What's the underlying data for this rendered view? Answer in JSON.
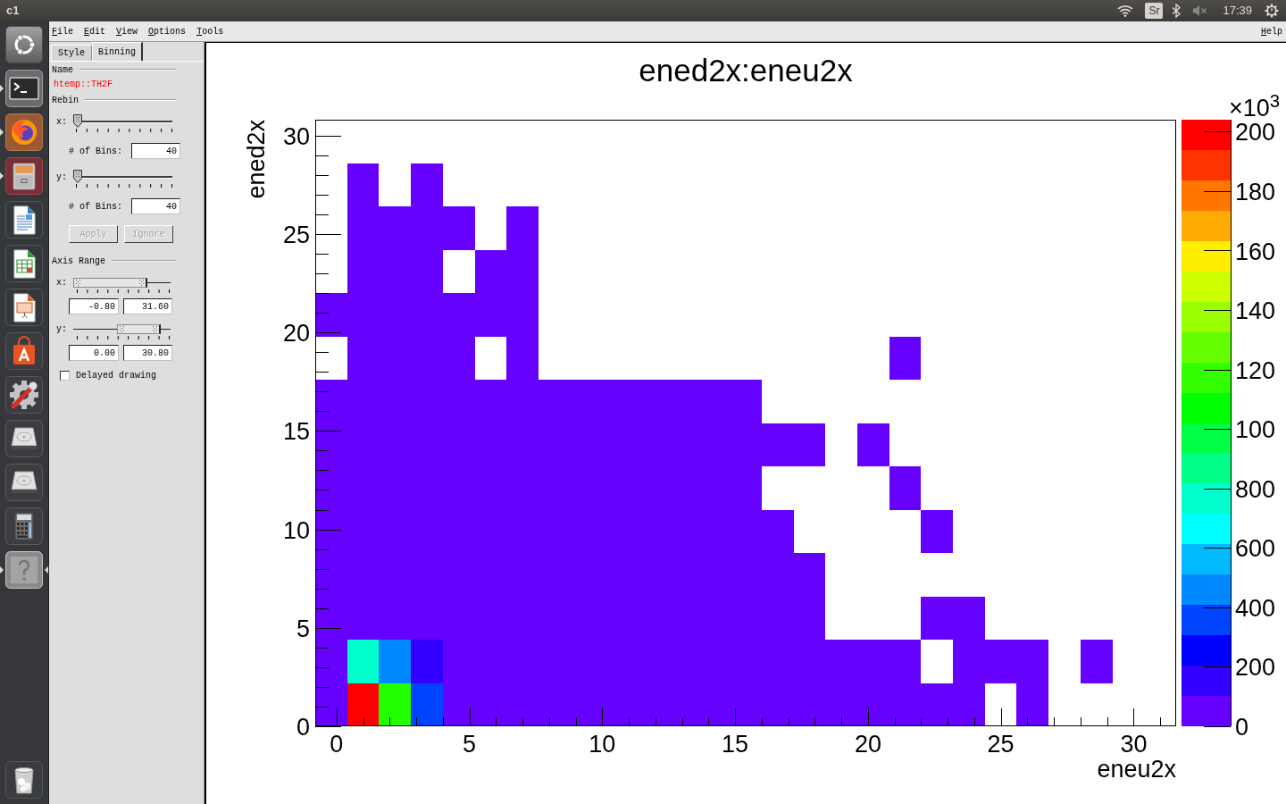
{
  "top_bar": {
    "title": "c1",
    "keyboard_layout": "Sr",
    "sound_muted": true,
    "clock": "17:39"
  },
  "launcher": {
    "items": [
      {
        "kind": "home",
        "running": false,
        "focused": false
      },
      {
        "kind": "terminal",
        "running": true,
        "focused": false
      },
      {
        "kind": "browser",
        "running": true,
        "focused": false
      },
      {
        "kind": "files",
        "running": true,
        "focused": false
      },
      {
        "kind": "writer",
        "running": false,
        "focused": false
      },
      {
        "kind": "spreadsheet",
        "running": false,
        "focused": false
      },
      {
        "kind": "presentation",
        "running": false,
        "focused": false
      },
      {
        "kind": "store",
        "running": false,
        "focused": false
      },
      {
        "kind": "settings",
        "running": false,
        "focused": false
      },
      {
        "kind": "disk",
        "running": false,
        "focused": false
      },
      {
        "kind": "disk",
        "running": false,
        "focused": false
      },
      {
        "kind": "calculator",
        "running": false,
        "focused": false
      },
      {
        "kind": "unknown",
        "running": true,
        "focused": true
      },
      {
        "kind": "trash",
        "running": false,
        "focused": false
      }
    ]
  },
  "menu_bar": {
    "menus": [
      "File",
      "Edit",
      "View",
      "Options",
      "Tools"
    ],
    "help_menu": "Help"
  },
  "editor": {
    "tabs": [
      {
        "label": "Style",
        "selected": false
      },
      {
        "label": "Binning",
        "selected": true
      }
    ],
    "name_section": {
      "heading": "Name",
      "object_name": "htemp::TH2F"
    },
    "rebin": {
      "heading": "Rebin",
      "axes": [
        {
          "label": "x:",
          "level": 0,
          "bins_label": "# of Bins:",
          "bins": "40"
        },
        {
          "label": "y:",
          "level": 0,
          "bins_label": "# of Bins:",
          "bins": "40"
        }
      ]
    },
    "buttons": [
      {
        "label": "Apply",
        "disabled": true
      },
      {
        "label": "Ignore",
        "disabled": true
      }
    ],
    "axis_range": {
      "heading": "Axis Range",
      "axes": [
        {
          "label": "x:",
          "thumbs": [
            {
              "level": 0
            },
            {
              "level": 0.76
            }
          ],
          "min": "-0.80",
          "max": "31.60"
        },
        {
          "label": "y:",
          "thumbs": [
            {
              "level": 0.45
            },
            {
              "level": 0.9
            }
          ],
          "min": "0.00",
          "max": "30.80"
        }
      ]
    },
    "delayed_drawing": {
      "label": "Delayed drawing",
      "checked": false
    }
  },
  "canvas": {
    "histogram_2d": {
      "title": "ened2x:eneu2x",
      "y_axis": {
        "title": "ened2x",
        "labels": [
          "30",
          "25",
          "20",
          "15",
          "10",
          "5",
          "0"
        ]
      },
      "rows": [
        {
          "cells": [
            {
              "kind": "gap"
            },
            {
              "kind": "bin",
              "color": "#6600ff"
            },
            {
              "kind": "gap"
            },
            {
              "kind": "bin",
              "color": "#6600ff"
            }
          ]
        },
        {
          "cells": [
            {
              "kind": "gap"
            },
            {
              "kind": "bin",
              "color": "#6600ff"
            },
            {
              "kind": "bin",
              "color": "#6600ff"
            },
            {
              "kind": "bin",
              "color": "#6600ff"
            },
            {
              "kind": "bin",
              "color": "#6600ff"
            },
            {
              "kind": "gap"
            },
            {
              "kind": "bin",
              "color": "#6600ff"
            }
          ]
        },
        {
          "cells": [
            {
              "kind": "gap"
            },
            {
              "kind": "bin",
              "color": "#6600ff"
            },
            {
              "kind": "bin",
              "color": "#6600ff"
            },
            {
              "kind": "bin",
              "color": "#6600ff"
            },
            {
              "kind": "gap"
            },
            {
              "kind": "bin",
              "color": "#6600ff"
            },
            {
              "kind": "bin",
              "color": "#6600ff"
            }
          ]
        },
        {
          "cells": [
            {
              "kind": "bin",
              "color": "#6600ff"
            },
            {
              "kind": "bin",
              "color": "#6600ff"
            },
            {
              "kind": "bin",
              "color": "#6600ff"
            },
            {
              "kind": "bin",
              "color": "#6600ff"
            },
            {
              "kind": "bin",
              "color": "#6600ff"
            },
            {
              "kind": "bin",
              "color": "#6600ff"
            },
            {
              "kind": "bin",
              "color": "#6600ff"
            }
          ]
        },
        {
          "cells": [
            {
              "kind": "gap"
            },
            {
              "kind": "bin",
              "color": "#6600ff"
            },
            {
              "kind": "bin",
              "color": "#6600ff"
            },
            {
              "kind": "bin",
              "color": "#6600ff"
            },
            {
              "kind": "bin",
              "color": "#6600ff"
            },
            {
              "kind": "gap"
            },
            {
              "kind": "bin",
              "color": "#6600ff"
            },
            {
              "kind": "gap"
            },
            {
              "kind": "gap"
            },
            {
              "kind": "gap"
            },
            {
              "kind": "gap"
            },
            {
              "kind": "gap"
            },
            {
              "kind": "gap"
            },
            {
              "kind": "gap"
            },
            {
              "kind": "gap"
            },
            {
              "kind": "gap"
            },
            {
              "kind": "gap"
            },
            {
              "kind": "gap"
            },
            {
              "kind": "bin",
              "color": "#6600ff"
            }
          ]
        },
        {
          "cells": [
            {
              "kind": "bin",
              "color": "#6600ff"
            },
            {
              "kind": "bin",
              "color": "#6600ff"
            },
            {
              "kind": "bin",
              "color": "#6600ff"
            },
            {
              "kind": "bin",
              "color": "#6600ff"
            },
            {
              "kind": "bin",
              "color": "#6600ff"
            },
            {
              "kind": "bin",
              "color": "#6600ff"
            },
            {
              "kind": "bin",
              "color": "#6600ff"
            },
            {
              "kind": "bin",
              "color": "#6600ff"
            },
            {
              "kind": "bin",
              "color": "#6600ff"
            },
            {
              "kind": "bin",
              "color": "#6600ff"
            },
            {
              "kind": "bin",
              "color": "#6600ff"
            },
            {
              "kind": "bin",
              "color": "#6600ff"
            },
            {
              "kind": "bin",
              "color": "#6600ff"
            },
            {
              "kind": "bin",
              "color": "#6600ff"
            }
          ]
        },
        {
          "cells": [
            {
              "kind": "bin",
              "color": "#6600ff"
            },
            {
              "kind": "bin",
              "color": "#6600ff"
            },
            {
              "kind": "bin",
              "color": "#6600ff"
            },
            {
              "kind": "bin",
              "color": "#6600ff"
            },
            {
              "kind": "bin",
              "color": "#6600ff"
            },
            {
              "kind": "bin",
              "color": "#6600ff"
            },
            {
              "kind": "bin",
              "color": "#6600ff"
            },
            {
              "kind": "bin",
              "color": "#6600ff"
            },
            {
              "kind": "bin",
              "color": "#6600ff"
            },
            {
              "kind": "bin",
              "color": "#6600ff"
            },
            {
              "kind": "bin",
              "color": "#6600ff"
            },
            {
              "kind": "bin",
              "color": "#6600ff"
            },
            {
              "kind": "bin",
              "color": "#6600ff"
            },
            {
              "kind": "bin",
              "color": "#6600ff"
            },
            {
              "kind": "bin",
              "color": "#6600ff"
            },
            {
              "kind": "bin",
              "color": "#6600ff"
            },
            {
              "kind": "gap"
            },
            {
              "kind": "bin",
              "color": "#6600ff"
            }
          ]
        },
        {
          "cells": [
            {
              "kind": "bin",
              "color": "#6600ff"
            },
            {
              "kind": "bin",
              "color": "#6600ff"
            },
            {
              "kind": "bin",
              "color": "#6600ff"
            },
            {
              "kind": "bin",
              "color": "#6600ff"
            },
            {
              "kind": "bin",
              "color": "#6600ff"
            },
            {
              "kind": "bin",
              "color": "#6600ff"
            },
            {
              "kind": "bin",
              "color": "#6600ff"
            },
            {
              "kind": "bin",
              "color": "#6600ff"
            },
            {
              "kind": "bin",
              "color": "#6600ff"
            },
            {
              "kind": "bin",
              "color": "#6600ff"
            },
            {
              "kind": "bin",
              "color": "#6600ff"
            },
            {
              "kind": "bin",
              "color": "#6600ff"
            },
            {
              "kind": "bin",
              "color": "#6600ff"
            },
            {
              "kind": "bin",
              "color": "#6600ff"
            },
            {
              "kind": "gap"
            },
            {
              "kind": "gap"
            },
            {
              "kind": "gap"
            },
            {
              "kind": "gap"
            },
            {
              "kind": "bin",
              "color": "#6600ff"
            }
          ]
        },
        {
          "cells": [
            {
              "kind": "bin",
              "color": "#6600ff"
            },
            {
              "kind": "bin",
              "color": "#6600ff"
            },
            {
              "kind": "bin",
              "color": "#6600ff"
            },
            {
              "kind": "bin",
              "color": "#6600ff"
            },
            {
              "kind": "bin",
              "color": "#6600ff"
            },
            {
              "kind": "bin",
              "color": "#6600ff"
            },
            {
              "kind": "bin",
              "color": "#6600ff"
            },
            {
              "kind": "bin",
              "color": "#6600ff"
            },
            {
              "kind": "bin",
              "color": "#6600ff"
            },
            {
              "kind": "bin",
              "color": "#6600ff"
            },
            {
              "kind": "bin",
              "color": "#6600ff"
            },
            {
              "kind": "bin",
              "color": "#6600ff"
            },
            {
              "kind": "bin",
              "color": "#6600ff"
            },
            {
              "kind": "bin",
              "color": "#6600ff"
            },
            {
              "kind": "bin",
              "color": "#6600ff"
            },
            {
              "kind": "gap"
            },
            {
              "kind": "gap"
            },
            {
              "kind": "gap"
            },
            {
              "kind": "gap"
            },
            {
              "kind": "bin",
              "color": "#6600ff"
            }
          ]
        },
        {
          "cells": [
            {
              "kind": "bin",
              "color": "#6600ff"
            },
            {
              "kind": "bin",
              "color": "#6600ff"
            },
            {
              "kind": "bin",
              "color": "#6600ff"
            },
            {
              "kind": "bin",
              "color": "#6600ff"
            },
            {
              "kind": "bin",
              "color": "#6600ff"
            },
            {
              "kind": "bin",
              "color": "#6600ff"
            },
            {
              "kind": "bin",
              "color": "#6600ff"
            },
            {
              "kind": "bin",
              "color": "#6600ff"
            },
            {
              "kind": "bin",
              "color": "#6600ff"
            },
            {
              "kind": "bin",
              "color": "#6600ff"
            },
            {
              "kind": "bin",
              "color": "#6600ff"
            },
            {
              "kind": "bin",
              "color": "#6600ff"
            },
            {
              "kind": "bin",
              "color": "#6600ff"
            },
            {
              "kind": "bin",
              "color": "#6600ff"
            },
            {
              "kind": "bin",
              "color": "#6600ff"
            },
            {
              "kind": "bin",
              "color": "#6600ff"
            }
          ]
        },
        {
          "cells": [
            {
              "kind": "bin",
              "color": "#6600ff"
            },
            {
              "kind": "bin",
              "color": "#6600ff"
            },
            {
              "kind": "bin",
              "color": "#6600ff"
            },
            {
              "kind": "bin",
              "color": "#6600ff"
            },
            {
              "kind": "bin",
              "color": "#6600ff"
            },
            {
              "kind": "bin",
              "color": "#6600ff"
            },
            {
              "kind": "bin",
              "color": "#6600ff"
            },
            {
              "kind": "bin",
              "color": "#6600ff"
            },
            {
              "kind": "bin",
              "color": "#6600ff"
            },
            {
              "kind": "bin",
              "color": "#6600ff"
            },
            {
              "kind": "bin",
              "color": "#6600ff"
            },
            {
              "kind": "bin",
              "color": "#6600ff"
            },
            {
              "kind": "bin",
              "color": "#6600ff"
            },
            {
              "kind": "bin",
              "color": "#6600ff"
            },
            {
              "kind": "bin",
              "color": "#6600ff"
            },
            {
              "kind": "bin",
              "color": "#6600ff"
            },
            {
              "kind": "gap"
            },
            {
              "kind": "gap"
            },
            {
              "kind": "gap"
            },
            {
              "kind": "bin",
              "color": "#6600ff"
            },
            {
              "kind": "bin",
              "color": "#6600ff"
            }
          ]
        },
        {
          "cells": [
            {
              "kind": "bin",
              "color": "#6600ff"
            },
            {
              "kind": "bin",
              "color": "#00ffcc"
            },
            {
              "kind": "bin",
              "color": "#0088ff"
            },
            {
              "kind": "bin",
              "color": "#3300ff"
            },
            {
              "kind": "bin",
              "color": "#6600ff"
            },
            {
              "kind": "bin",
              "color": "#6600ff"
            },
            {
              "kind": "bin",
              "color": "#6600ff"
            },
            {
              "kind": "bin",
              "color": "#6600ff"
            },
            {
              "kind": "bin",
              "color": "#6600ff"
            },
            {
              "kind": "bin",
              "color": "#6600ff"
            },
            {
              "kind": "bin",
              "color": "#6600ff"
            },
            {
              "kind": "bin",
              "color": "#6600ff"
            },
            {
              "kind": "bin",
              "color": "#6600ff"
            },
            {
              "kind": "bin",
              "color": "#6600ff"
            },
            {
              "kind": "bin",
              "color": "#6600ff"
            },
            {
              "kind": "bin",
              "color": "#6600ff"
            },
            {
              "kind": "bin",
              "color": "#6600ff"
            },
            {
              "kind": "bin",
              "color": "#6600ff"
            },
            {
              "kind": "bin",
              "color": "#6600ff"
            },
            {
              "kind": "gap"
            },
            {
              "kind": "bin",
              "color": "#6600ff"
            },
            {
              "kind": "bin",
              "color": "#6600ff"
            },
            {
              "kind": "bin",
              "color": "#6600ff"
            },
            {
              "kind": "gap"
            },
            {
              "kind": "bin",
              "color": "#6600ff"
            }
          ]
        },
        {
          "cells": [
            {
              "kind": "bin",
              "color": "#6600ff"
            },
            {
              "kind": "bin",
              "color": "#ff0000"
            },
            {
              "kind": "bin",
              "color": "#22ff00"
            },
            {
              "kind": "bin",
              "color": "#0044ff"
            },
            {
              "kind": "bin",
              "color": "#6600ff"
            },
            {
              "kind": "bin",
              "color": "#6600ff"
            },
            {
              "kind": "bin",
              "color": "#6600ff"
            },
            {
              "kind": "bin",
              "color": "#6600ff"
            },
            {
              "kind": "bin",
              "color": "#6600ff"
            },
            {
              "kind": "bin",
              "color": "#6600ff"
            },
            {
              "kind": "bin",
              "color": "#6600ff"
            },
            {
              "kind": "bin",
              "color": "#6600ff"
            },
            {
              "kind": "bin",
              "color": "#6600ff"
            },
            {
              "kind": "bin",
              "color": "#6600ff"
            },
            {
              "kind": "bin",
              "color": "#6600ff"
            },
            {
              "kind": "bin",
              "color": "#6600ff"
            },
            {
              "kind": "bin",
              "color": "#6600ff"
            },
            {
              "kind": "bin",
              "color": "#6600ff"
            },
            {
              "kind": "bin",
              "color": "#6600ff"
            },
            {
              "kind": "bin",
              "color": "#6600ff"
            },
            {
              "kind": "bin",
              "color": "#6600ff"
            },
            {
              "kind": "gap"
            },
            {
              "kind": "bin",
              "color": "#6600ff"
            }
          ]
        }
      ],
      "x_axis": {
        "title": "eneu2x",
        "labels": [
          "0",
          "5",
          "10",
          "15",
          "20",
          "25",
          "30"
        ]
      }
    },
    "color_scale": {
      "multiplier": "×10$^{3}$",
      "bands": [
        {
          "color": "#ff0000"
        },
        {
          "color": "#ff3300"
        },
        {
          "color": "#ff7700"
        },
        {
          "color": "#ffaa00"
        },
        {
          "color": "#ffee00"
        },
        {
          "color": "#ccff00"
        },
        {
          "color": "#99ff00"
        },
        {
          "color": "#66ff00"
        },
        {
          "color": "#33ff00"
        },
        {
          "color": "#00ff00"
        },
        {
          "color": "#00ff44"
        },
        {
          "color": "#00ff88"
        },
        {
          "color": "#00ffcc"
        },
        {
          "color": "#00ffff"
        },
        {
          "color": "#00bbff"
        },
        {
          "color": "#0088ff"
        },
        {
          "color": "#0044ff"
        },
        {
          "color": "#0000ff"
        },
        {
          "color": "#3300ff"
        },
        {
          "color": "#6600ff"
        }
      ],
      "labels": [
        "200",
        "180",
        "160",
        "140",
        "120",
        "100",
        "800",
        "600",
        "400",
        "200",
        "0"
      ]
    }
  }
}
